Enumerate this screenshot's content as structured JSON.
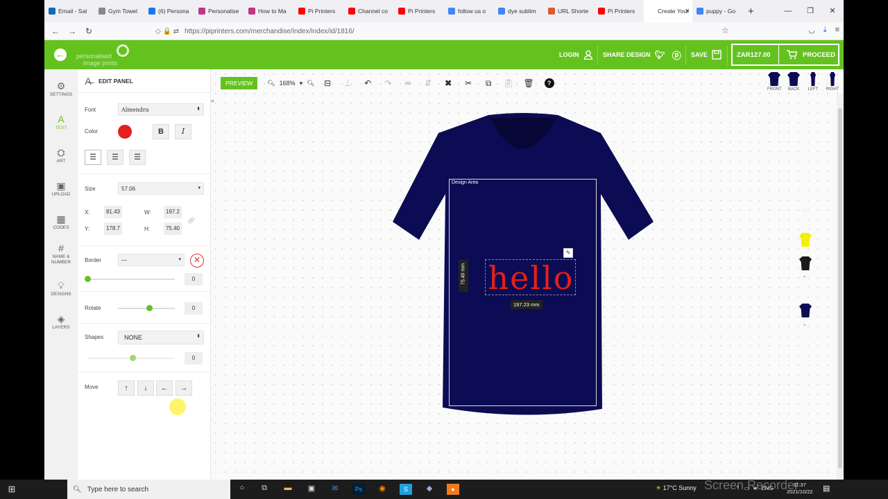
{
  "browser": {
    "tabs": [
      {
        "label": "Email - Sal",
        "icon_color": "#0f6cbd"
      },
      {
        "label": "Gym Towel",
        "icon_color": "#888888"
      },
      {
        "label": "(6) Persona",
        "icon_color": "#1877f2"
      },
      {
        "label": "Personalise",
        "icon_color": "#c13584"
      },
      {
        "label": "How to Ma",
        "icon_color": "#c13584"
      },
      {
        "label": "Pi Printers",
        "icon_color": "#ff0000"
      },
      {
        "label": "Channel co",
        "icon_color": "#ff0000"
      },
      {
        "label": "Pi Printers",
        "icon_color": "#ff0000"
      },
      {
        "label": "follow us o",
        "icon_color": "#4285f4"
      },
      {
        "label": "dye sublim",
        "icon_color": "#4285f4"
      },
      {
        "label": "URL Shorte",
        "icon_color": "#e05a2b"
      },
      {
        "label": "Pi Printers",
        "icon_color": "#ff0000"
      },
      {
        "label": "Create Your",
        "icon_color": "#ffffff",
        "active": true
      },
      {
        "label": "puppy - Go",
        "icon_color": "#4285f4"
      }
    ],
    "url": "https://piprinters.com/merchandise/index/index/id/1816/"
  },
  "header": {
    "logo_line1": "personalised",
    "logo_line2": "image prints",
    "login": "LOGIN",
    "share": "SHARE DESIGN",
    "save": "SAVE",
    "price": "ZAR127.00",
    "proceed": "PROCEED",
    "brand_color": "#64c21f"
  },
  "sidebar": {
    "items": [
      {
        "label": "SETTINGS",
        "icon": "gear-icon"
      },
      {
        "label": "TEXT",
        "icon": "text-icon"
      },
      {
        "label": "ART",
        "icon": "art-icon"
      },
      {
        "label": "UPLOAD",
        "icon": "image-icon"
      },
      {
        "label": "CODES",
        "icon": "qr-icon"
      },
      {
        "label": "NAME &",
        "label2": "NUMBER",
        "icon": "hash-icon"
      },
      {
        "label": "DESIGNS",
        "icon": "bulb-icon"
      },
      {
        "label": "LAYERS",
        "icon": "layers-icon"
      }
    ]
  },
  "panel": {
    "title": "EDIT PANEL",
    "font_label": "Font",
    "font_value": "Almendra",
    "color_label": "Color",
    "text_color": "#e3201b",
    "bold": "B",
    "italic": "I",
    "size_label": "Size",
    "size_value": "57.06",
    "x_label": "X:",
    "x_value": "81.43",
    "w_label": "W:",
    "w_value": "197.2",
    "y_label": "Y:",
    "y_value": "178.7",
    "h_label": "H:",
    "h_value": "75.40",
    "border_label": "Border",
    "border_value": "—",
    "border_width": "0",
    "rotate_label": "Rotate",
    "rotate_value": "0",
    "shapes_label": "Shapes",
    "shapes_value": "NONE",
    "shape_value": "0",
    "move_label": "Move"
  },
  "toolbar": {
    "preview": "PREVIEW",
    "zoom": "168%"
  },
  "views": [
    {
      "label": "FRONT"
    },
    {
      "label": "BACK"
    },
    {
      "label": "LEFT"
    },
    {
      "label": "RIGHT"
    }
  ],
  "design": {
    "area_label": "Design Area",
    "text": "hello",
    "width_label": "197.23 mm",
    "height_label": "75.40 mm",
    "shirt_color": "#0c0c54"
  },
  "product_colors": [
    "#f5f000",
    "#1a1a1a",
    "#0c0c54"
  ],
  "taskbar": {
    "search_placeholder": "Type here to search",
    "weather": "17°C  Sunny",
    "lang": "ENG",
    "time": "11:37",
    "date": "2021/10/22"
  },
  "watermark": "Screen Recorder"
}
